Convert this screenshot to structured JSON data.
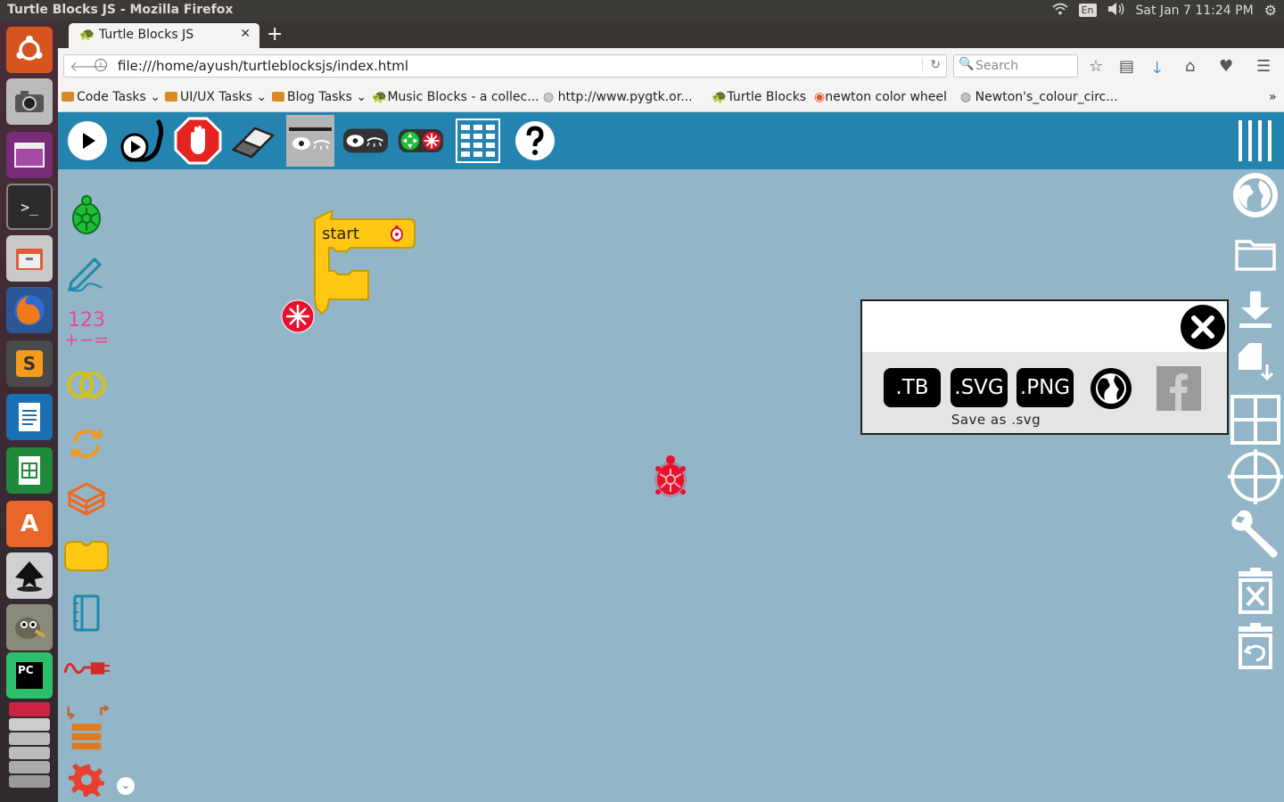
{
  "desktop": {
    "window_title": "Turtle Blocks JS - Mozilla Firefox",
    "keyboard_lang": "En",
    "clock": "Sat Jan  7 11:24 PM"
  },
  "browser": {
    "tab_title": "Turtle Blocks JS",
    "url": "file:///home/ayush/turtleblocksjs/index.html",
    "search_placeholder": "Search",
    "bookmarks": [
      {
        "label": "Code Tasks",
        "dropdown": true
      },
      {
        "label": "UI/UX Tasks",
        "dropdown": true
      },
      {
        "label": "Blog Tasks",
        "dropdown": true
      },
      {
        "label": "Music Blocks - a collec..."
      },
      {
        "label": "http://www.pygtk.or..."
      },
      {
        "label": "Turtle Blocks"
      },
      {
        "label": "newton color wheel"
      },
      {
        "label": "Newton's_colour_circ..."
      }
    ]
  },
  "app": {
    "start_block_label": "start",
    "palette_number_label_top": "123",
    "palette_number_label_bottom": "+−=",
    "save_dialog": {
      "buttons": [
        ".TB",
        ".SVG",
        ".PNG"
      ],
      "caption": "Save as .svg"
    },
    "colors": {
      "toolbar": "#2584af",
      "canvas": "#92b5c8",
      "block": "#ffc815",
      "turtle": "#e8102c"
    }
  }
}
